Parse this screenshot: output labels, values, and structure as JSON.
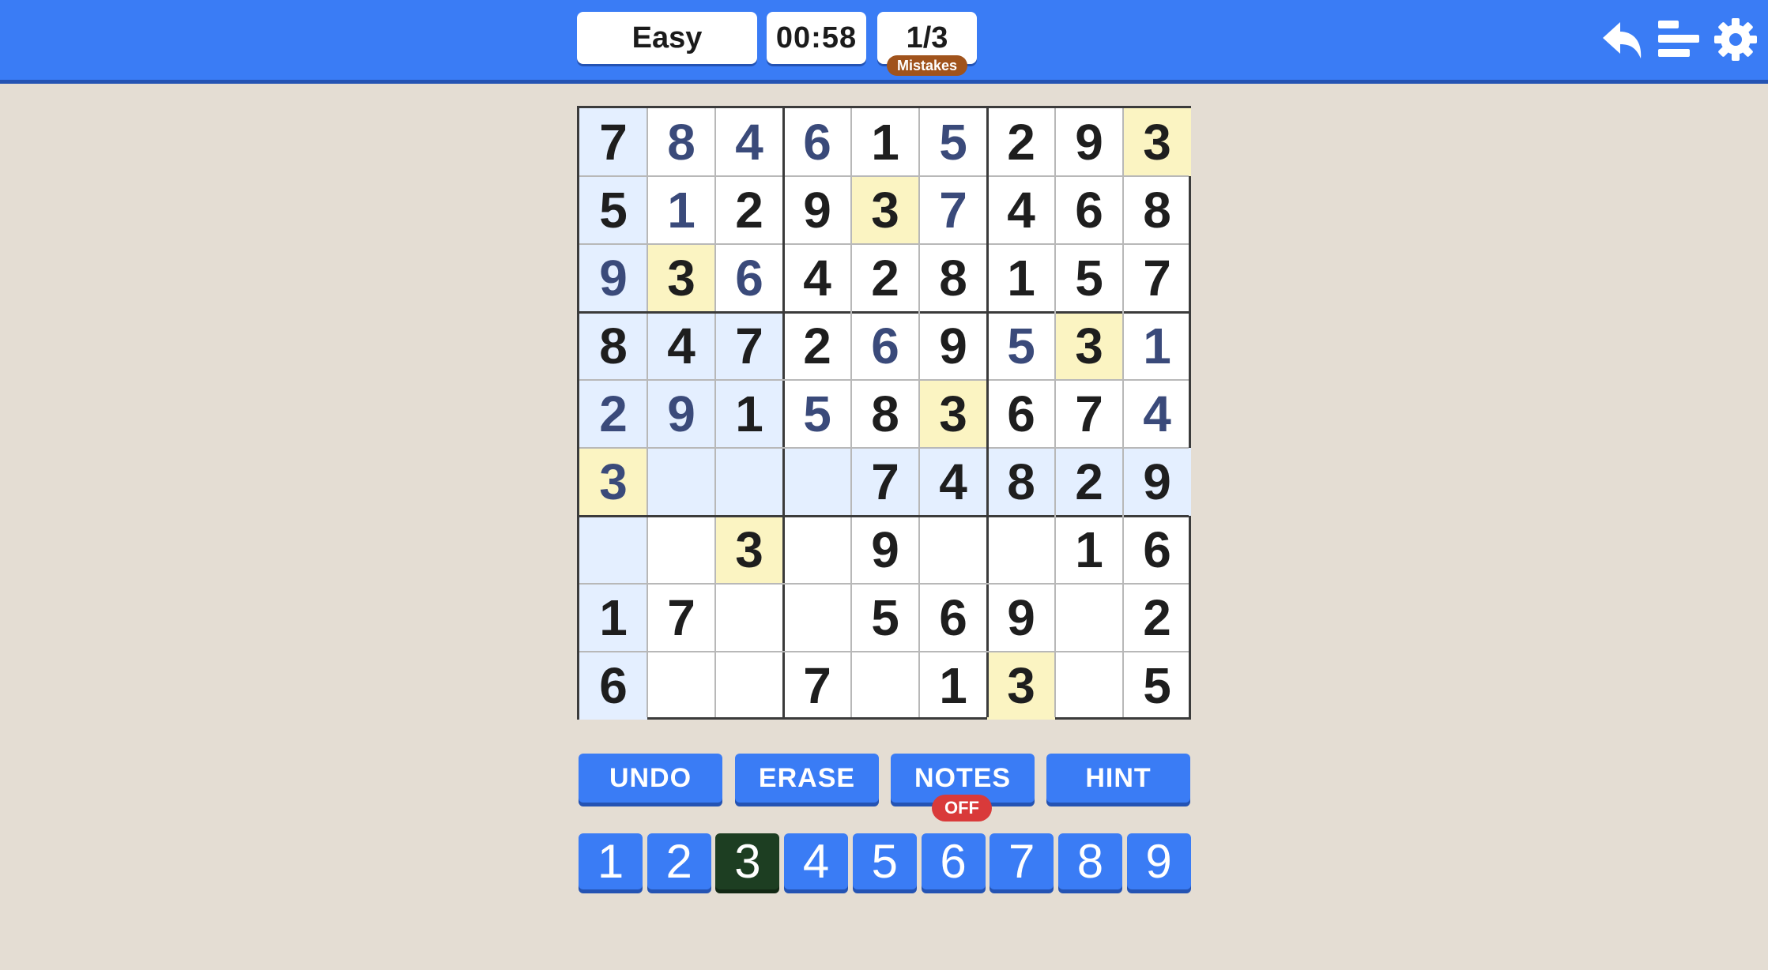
{
  "header": {
    "difficulty": "Easy",
    "timer": "00:58",
    "mistakes": "1/3",
    "mistakes_label": "Mistakes",
    "icons": [
      "back-arrow-icon",
      "stats-icon",
      "gear-icon"
    ]
  },
  "colors": {
    "accent": "#3a7cf5",
    "row_col_highlight": "#e4efff",
    "same_number_highlight": "#fbf4c2",
    "user_entry": "#3a4a7a",
    "notes_off_badge": "#d93a3a",
    "selected_number": "#1d3e22"
  },
  "board": {
    "rows": [
      [
        "7",
        "8",
        "4",
        "6",
        "1",
        "5",
        "2",
        "9",
        "3"
      ],
      [
        "5",
        "1",
        "2",
        "9",
        "3",
        "7",
        "4",
        "6",
        "8"
      ],
      [
        "9",
        "3",
        "6",
        "4",
        "2",
        "8",
        "1",
        "5",
        "7"
      ],
      [
        "8",
        "4",
        "7",
        "2",
        "6",
        "9",
        "5",
        "3",
        "1"
      ],
      [
        "2",
        "9",
        "1",
        "5",
        "8",
        "3",
        "6",
        "7",
        "4"
      ],
      [
        "3",
        "",
        "",
        "",
        "7",
        "4",
        "8",
        "2",
        "9"
      ],
      [
        "",
        "",
        "3",
        "",
        "9",
        "",
        "",
        "1",
        "6"
      ],
      [
        "1",
        "7",
        "",
        "",
        "5",
        "6",
        "9",
        "",
        "2"
      ],
      [
        "6",
        "",
        "",
        "7",
        "",
        "1",
        "3",
        "",
        "5"
      ]
    ],
    "user_entries": [
      [
        0,
        1
      ],
      [
        0,
        2
      ],
      [
        0,
        3
      ],
      [
        0,
        5
      ],
      [
        1,
        1
      ],
      [
        1,
        5
      ],
      [
        2,
        0
      ],
      [
        2,
        2
      ],
      [
        3,
        4
      ],
      [
        3,
        6
      ],
      [
        3,
        8
      ],
      [
        4,
        0
      ],
      [
        4,
        1
      ],
      [
        4,
        3
      ],
      [
        4,
        8
      ],
      [
        5,
        0
      ]
    ],
    "selected_cell": [
      5,
      0
    ],
    "selected_number": "3"
  },
  "actions": {
    "undo": "UNDO",
    "erase": "ERASE",
    "notes": "NOTES",
    "notes_state": "OFF",
    "hint": "HINT"
  },
  "numpad": [
    "1",
    "2",
    "3",
    "4",
    "5",
    "6",
    "7",
    "8",
    "9"
  ]
}
